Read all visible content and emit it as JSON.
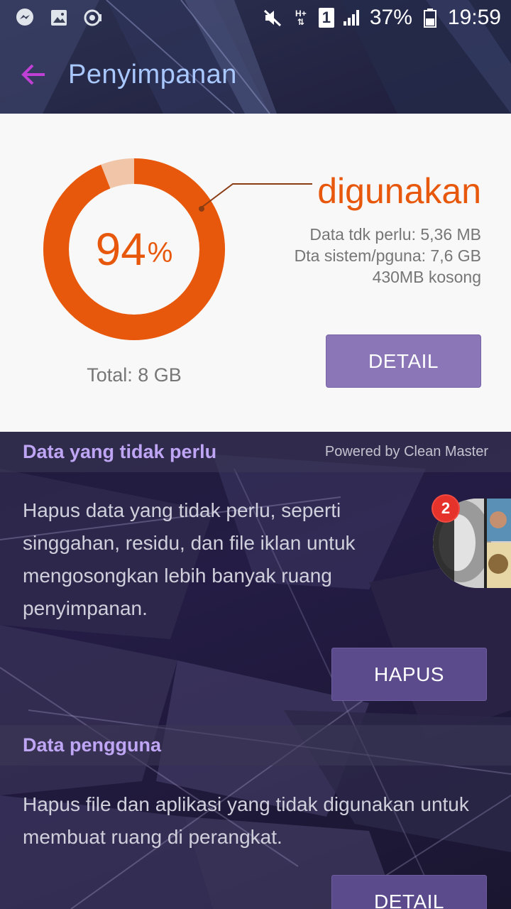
{
  "status_bar": {
    "battery": "37%",
    "time": "19:59",
    "sim_slot": "1",
    "network_type": "H+",
    "icons_left": [
      "messenger-icon",
      "gallery-icon",
      "sync-icon"
    ],
    "icons_right": [
      "mute-icon",
      "data-icon",
      "sim-icon",
      "signal-icon",
      "battery-icon"
    ]
  },
  "app_bar": {
    "title": "Penyimpanan"
  },
  "storage": {
    "percent": "94",
    "percent_sign": "%",
    "used_fraction": 0.94,
    "used_label": "digunakan",
    "junk_line": "Data tdk perlu: 5,36 MB",
    "system_line": "Dta sistem/pguna: 7,6 GB",
    "free_line": "430MB kosong",
    "total": "Total: 8 GB",
    "detail_button": "DETAIL",
    "colors": {
      "used": "#e8580c",
      "free": "#f1c6a8"
    }
  },
  "junk_section": {
    "title": "Data yang tidak perlu",
    "powered_by": "Powered by Clean Master",
    "description": "Hapus data yang tidak perlu, seperti singgahan, residu, dan file iklan untuk mengosongkan lebih banyak ruang penyimpanan.",
    "button": "HAPUS"
  },
  "user_section": {
    "title": "Data pengguna",
    "description": "Hapus file dan aplikasi yang tidak digunakan untuk membuat ruang di perangkat.",
    "button": "DETAIL"
  },
  "chat_head": {
    "badge": "2"
  }
}
